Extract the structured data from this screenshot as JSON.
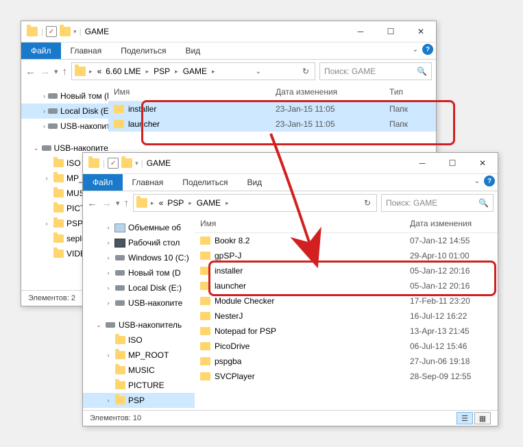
{
  "window1": {
    "title": "GAME",
    "tabs": {
      "file": "Файл",
      "home": "Главная",
      "share": "Поделиться",
      "view": "Вид"
    },
    "breadcrumb": [
      "6.60 LME",
      "PSP",
      "GAME"
    ],
    "breadcrumb_prefix": "«",
    "search_placeholder": "Поиск: GAME",
    "columns": {
      "name": "Имя",
      "date": "Дата изменения",
      "type": "Тип"
    },
    "rows": [
      {
        "name": "installer",
        "date": "23-Jan-15 11:05",
        "type": "Папк"
      },
      {
        "name": "launcher",
        "date": "23-Jan-15 11:05",
        "type": "Папк"
      }
    ],
    "tree": [
      {
        "label": "Новый том (D:)",
        "icon": "disk",
        "indent": 2,
        "caret": ">"
      },
      {
        "label": "Local Disk (E:)",
        "icon": "disk",
        "indent": 2,
        "caret": ">",
        "selected": true
      },
      {
        "label": "USB-накопитель",
        "icon": "disk",
        "indent": 2,
        "caret": ">"
      },
      {
        "label": "",
        "icon": "",
        "indent": 0,
        "caret": ""
      },
      {
        "label": "USB-накопитель",
        "icon": "disk",
        "indent": 1,
        "caret": "v"
      },
      {
        "label": "ISO",
        "icon": "fold",
        "indent": 2,
        "caret": ""
      },
      {
        "label": "MP_ROOT",
        "icon": "fold",
        "indent": 2,
        "caret": ">"
      },
      {
        "label": "MUSIC",
        "icon": "fold",
        "indent": 2,
        "caret": ""
      },
      {
        "label": "PICTURE",
        "icon": "fold",
        "indent": 2,
        "caret": ""
      },
      {
        "label": "PSP",
        "icon": "fold",
        "indent": 2,
        "caret": ">"
      },
      {
        "label": "seplugins",
        "icon": "fold",
        "indent": 2,
        "caret": ""
      },
      {
        "label": "VIDEO",
        "icon": "fold",
        "indent": 2,
        "caret": ""
      }
    ],
    "status": "Элементов: 2"
  },
  "window2": {
    "title": "GAME",
    "tabs": {
      "file": "Файл",
      "home": "Главная",
      "share": "Поделиться",
      "view": "Вид"
    },
    "breadcrumb": [
      "PSP",
      "GAME"
    ],
    "breadcrumb_prefix": "«",
    "search_placeholder": "Поиск: GAME",
    "columns": {
      "name": "Имя",
      "date": "Дата изменения"
    },
    "rows": [
      {
        "name": "Bookr 8.2",
        "date": "07-Jan-12 14:55"
      },
      {
        "name": "gpSP-J",
        "date": "29-Apr-10 01:00"
      },
      {
        "name": "installer",
        "date": "05-Jan-12 20:16",
        "highlighted": true
      },
      {
        "name": "launcher",
        "date": "05-Jan-12 20:16",
        "highlighted": true
      },
      {
        "name": "Module Checker",
        "date": "17-Feb-11 23:20"
      },
      {
        "name": "NesterJ",
        "date": "16-Jul-12 16:22"
      },
      {
        "name": "Notepad for PSP",
        "date": "13-Apr-13 21:45"
      },
      {
        "name": "PicoDrive",
        "date": "06-Jul-12 15:46"
      },
      {
        "name": "pspgba",
        "date": "27-Jun-06 19:18"
      },
      {
        "name": "SVCPlayer",
        "date": "28-Sep-09 12:55"
      }
    ],
    "tree": [
      {
        "label": "Объемные об",
        "icon": "pc",
        "indent": 2,
        "caret": ">"
      },
      {
        "label": "Рабочий стол",
        "icon": "pcdark",
        "indent": 2,
        "caret": ">"
      },
      {
        "label": "Windows 10 (C:)",
        "icon": "disk",
        "indent": 2,
        "caret": ">"
      },
      {
        "label": "Новый том (D",
        "icon": "disk",
        "indent": 2,
        "caret": ">"
      },
      {
        "label": "Local Disk (E:)",
        "icon": "disk",
        "indent": 2,
        "caret": ">"
      },
      {
        "label": "USB-накопите",
        "icon": "disk",
        "indent": 2,
        "caret": ">"
      },
      {
        "label": "",
        "icon": "",
        "indent": 0,
        "caret": ""
      },
      {
        "label": "USB-накопитель",
        "icon": "disk",
        "indent": 1,
        "caret": "v"
      },
      {
        "label": "ISO",
        "icon": "fold",
        "indent": 2,
        "caret": ""
      },
      {
        "label": "MP_ROOT",
        "icon": "fold",
        "indent": 2,
        "caret": ">"
      },
      {
        "label": "MUSIC",
        "icon": "fold",
        "indent": 2,
        "caret": ""
      },
      {
        "label": "PICTURE",
        "icon": "fold",
        "indent": 2,
        "caret": ""
      },
      {
        "label": "PSP",
        "icon": "fold",
        "indent": 2,
        "caret": ">",
        "selected": true
      }
    ],
    "status": "Элементов: 10"
  }
}
